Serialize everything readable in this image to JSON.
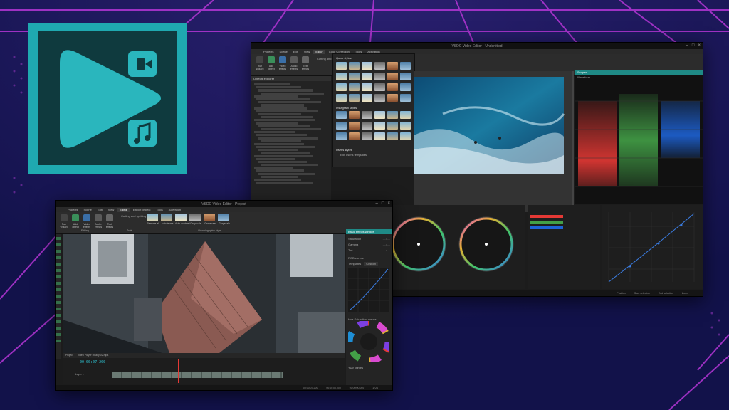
{
  "colors": {
    "accent": "#1fa9b0",
    "background": "#12124a",
    "grid": "#b536d6",
    "red": "#e53935",
    "green": "#43a047",
    "blue": "#1e63d6"
  },
  "logo": {
    "icons": [
      "play-icon",
      "video-camera-icon",
      "music-note-icon"
    ]
  },
  "back_window": {
    "title": "VSDC Video Editor - Undertitled",
    "menu": [
      "Projects",
      "Scene",
      "Edit",
      "View",
      "Editor",
      "Color Correction",
      "Tools",
      "Activation"
    ],
    "active_menu": "Editor",
    "ribbon_buttons": [
      "Run Wizard",
      "Add object",
      "Video effects",
      "Audio effects",
      "Text effects",
      "Cutting and splitting"
    ],
    "objects_panel_title": "Objects explorer",
    "styles_popup": {
      "quick_styles_label": "Quick styles",
      "instagram_label": "Instagram styles",
      "user_styles_label": "User's styles",
      "edit_user_templates": "Edit user's templates"
    },
    "scopes_title": "Scopes",
    "scopes_dropdown": "Waveform",
    "status": {
      "position": "Position",
      "start_selection": "Start selection",
      "end_selection": "End selection",
      "zoom": "Zoom"
    }
  },
  "front_window": {
    "title": "VSDC Video Editor - Project",
    "menu": [
      "Projects",
      "Scene",
      "Edit",
      "View",
      "Editor",
      "Export project",
      "Tools",
      "Activation"
    ],
    "active_menu": "Editor",
    "ribbon_buttons": [
      "Run Wizard",
      "Add object",
      "Video effects",
      "Audio effects",
      "Text effects"
    ],
    "ribbon_group_editing": "Editing",
    "ribbon_group_tools": "Tools",
    "ribbon_group_quick_style": "Choosing quick style",
    "cutting": "Cutting and splitting",
    "quick_styles": [
      "Remove all",
      "Auto levels",
      "Auto contrast",
      "Grayscale",
      "Grayscale",
      "Grayscale"
    ],
    "timecode": "00:00:07.200",
    "effects_panel_title": "Basic effects window",
    "effects_rows": [
      "Saturation",
      "Gamma",
      "Tint"
    ],
    "rgb_curves": "RGB curves",
    "templates_label": "Templates",
    "templates_value": "Custom",
    "hue_sat_curves": "Hue Saturation curves",
    "yuv_curves": "YUV curves",
    "timeline_tabs": [
      "Project",
      "Video Player Ready 02.mp4"
    ],
    "layer": "Layer 1",
    "status": {
      "position": "00:00:07.200",
      "start_selection": "00:00:00.000",
      "end_selection": "00:00:00.000",
      "zoom": "1724"
    }
  }
}
